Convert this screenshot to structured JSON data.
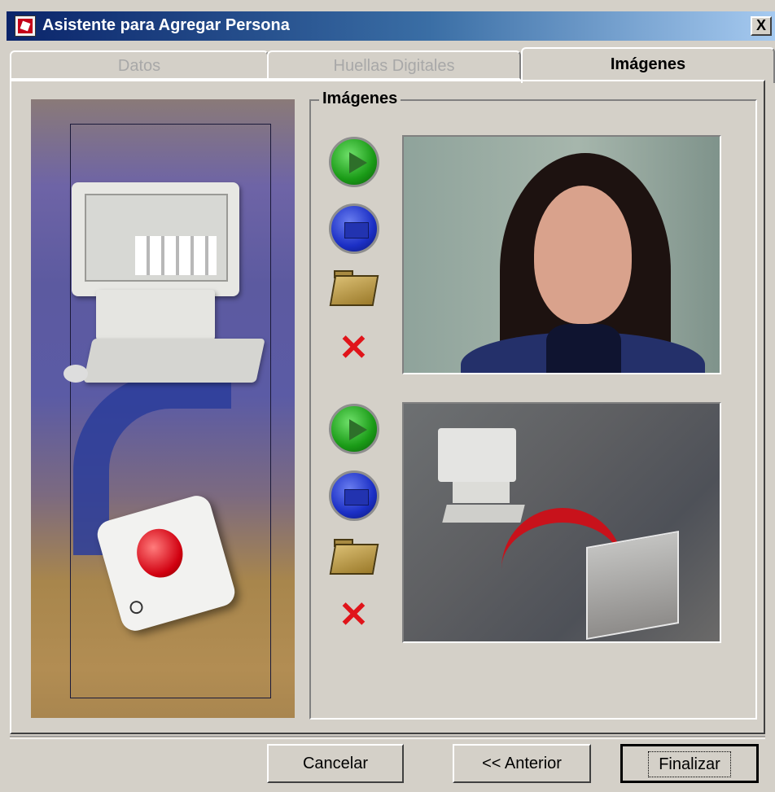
{
  "window": {
    "title": "Asistente para Agregar Persona",
    "close_label": "X"
  },
  "tabs": [
    {
      "label": "Datos",
      "active": false
    },
    {
      "label": "Huellas Digitales",
      "active": false
    },
    {
      "label": "Imágenes",
      "active": true
    }
  ],
  "images_group": {
    "legend": "Imágenes",
    "slots": [
      {
        "actions": [
          "play-icon",
          "camera-icon",
          "folder-icon",
          "delete-icon"
        ]
      },
      {
        "actions": [
          "play-icon",
          "camera-icon",
          "folder-icon",
          "delete-icon"
        ]
      }
    ]
  },
  "icons": {
    "delete": "✕"
  },
  "buttons": {
    "cancel": "Cancelar",
    "previous": "<<  Anterior",
    "finish": "Finalizar"
  },
  "colors": {
    "title_gradient_start": "#0a246a",
    "title_gradient_end": "#a6caf0",
    "face_bg": "#d4d0c8",
    "play_green": "#1a9b17",
    "capture_blue": "#1b2fc5",
    "delete_red": "#e0141a"
  }
}
